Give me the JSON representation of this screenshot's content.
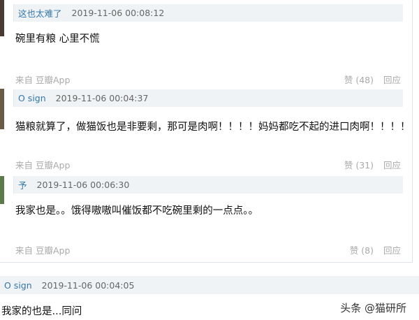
{
  "comments": [
    {
      "author": "这也太难了",
      "time": "2019-11-06 00:08:12",
      "text": "碗里有粮 心里不慌",
      "source": "来自 豆瓣App",
      "like": "赞 (48)",
      "reply": "回应"
    },
    {
      "author": "O sign",
      "time": "2019-11-06 00:04:37",
      "text": "猫粮就算了，做猫饭也是非要剩，那可是肉啊！！！！妈妈都吃不起的进口肉啊！！！！",
      "source": "来自 豆瓣App",
      "like": "赞 (31)",
      "reply": "回应"
    },
    {
      "author": "予",
      "time": "2019-11-06 00:06:30",
      "text": "我家也是。。饿得嗷嗷叫催饭都不吃碗里剩的一点点。。",
      "source": "来自 豆瓣App",
      "like": "赞 (8)",
      "reply": "回应"
    }
  ],
  "outer_comment": {
    "author": "O sign",
    "time": "2019-11-06 00:04:05",
    "text": "我家的也是...同问"
  },
  "watermark": "头条 @猫研所",
  "colors": {
    "author_link": "#3377aa",
    "header_bg": "#f0f3f5",
    "meta_gray": "#aaaaaa"
  }
}
